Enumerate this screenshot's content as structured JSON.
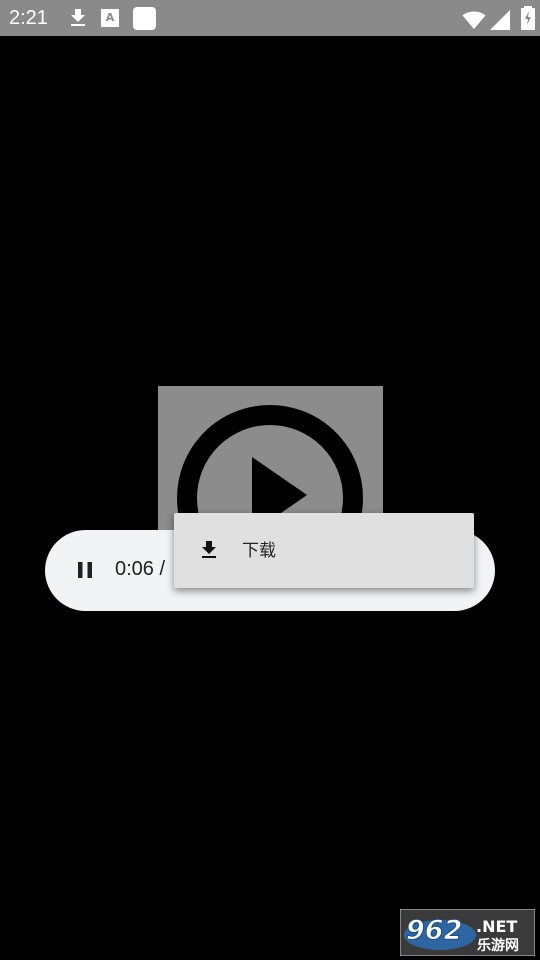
{
  "status_bar": {
    "time": "2:21",
    "a_badge": "A",
    "icons": [
      "download-icon",
      "a-badge-icon",
      "square-icon",
      "wifi-icon",
      "signal-icon",
      "battery-charging-icon"
    ]
  },
  "player": {
    "time_text": "0:06 /",
    "pause_icon": "pause-icon"
  },
  "context_menu": {
    "items": [
      {
        "label": "下载",
        "icon": "download-icon"
      }
    ]
  },
  "watermark": {
    "logo": "962.NET 乐游网"
  },
  "colors": {
    "status_bar_bg": "#8a8a8a",
    "background": "#000000",
    "player_bar_bg": "#f1f3f4",
    "menu_bg": "#e0e0e0"
  }
}
